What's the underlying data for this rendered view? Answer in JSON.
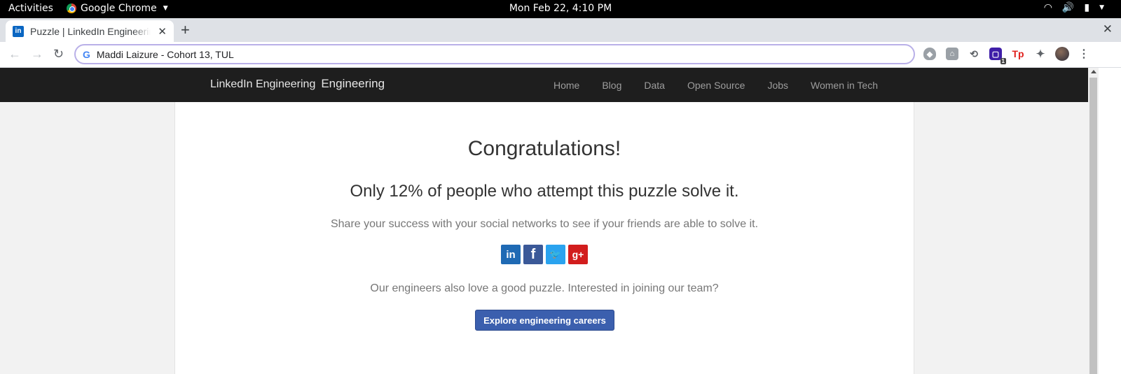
{
  "os_topbar": {
    "activities": "Activities",
    "app_name": "Google Chrome",
    "datetime": "Mon Feb 22,  4:10 PM"
  },
  "browser": {
    "tab_title": "Puzzle | LinkedIn Engineering",
    "tab_favicon": "in",
    "omnibox_text": "Maddi Laizure - Cohort 13, TUL",
    "extension_badge": "1"
  },
  "site": {
    "brand_image_alt": "LinkedIn Engineering",
    "brand_name": "Engineering",
    "nav": [
      "Home",
      "Blog",
      "Data",
      "Open Source",
      "Jobs",
      "Women in Tech"
    ]
  },
  "main": {
    "heading": "Congratulations!",
    "stat": "Only 12% of people who attempt this puzzle solve it.",
    "share_text": "Share your success with your social networks to see if your friends are able to solve it.",
    "social": [
      {
        "name": "linkedin-icon",
        "glyph": "in",
        "color": "#1f6ab4"
      },
      {
        "name": "facebook-icon",
        "glyph": "f",
        "color": "#3b5998"
      },
      {
        "name": "twitter-icon",
        "glyph": "🐦",
        "color": "#2aa3ef"
      },
      {
        "name": "google-plus-icon",
        "glyph": "g+",
        "color": "#d21d1d"
      }
    ],
    "join_text": "Our engineers also love a good puzzle. Interested in joining our team?",
    "cta_label": "Explore engineering careers"
  }
}
